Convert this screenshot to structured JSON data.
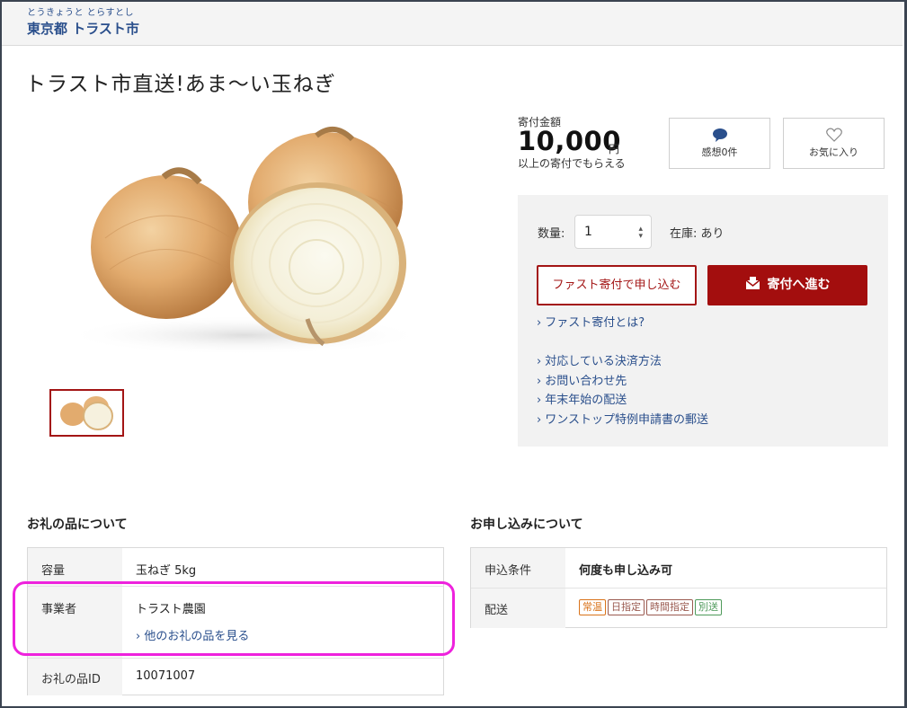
{
  "header": {
    "ruby": "とうきょうと とらすとし",
    "city": "東京都 トラスト市"
  },
  "product": {
    "title": "トラスト市直送!あま〜い玉ねぎ"
  },
  "price": {
    "label": "寄付金額",
    "amount": "10,000",
    "unit": "円",
    "note": "以上の寄付でもらえる"
  },
  "actions": {
    "reviews_label": "感想0件",
    "favorite_label": "お気に入り"
  },
  "order": {
    "qty_label": "数量:",
    "qty_value": "1",
    "stock_label": "在庫: あり",
    "fast_button": "ファスト寄付で申し込む",
    "donate_button": "寄付へ進む",
    "fast_link": "ファスト寄付とは?",
    "links": [
      "対応している決済方法",
      "お問い合わせ先",
      "年末年始の配送",
      "ワンストップ特例申請書の郵送"
    ]
  },
  "gift_info": {
    "title": "お礼の品について",
    "rows": [
      {
        "label": "容量",
        "value": "玉ねぎ 5kg"
      },
      {
        "label": "事業者",
        "value": "トラスト農園",
        "link": "他のお礼の品を見る"
      },
      {
        "label": "お礼の品ID",
        "value": "10071007"
      }
    ]
  },
  "apply_info": {
    "title": "お申し込みについて",
    "rows": [
      {
        "label": "申込条件",
        "value": "何度も申し込み可"
      },
      {
        "label": "配送",
        "tags": [
          "常温",
          "日指定",
          "時間指定",
          "別送"
        ]
      }
    ]
  },
  "colors": {
    "accent_red": "#a30e0e",
    "link_blue": "#2a4f8c",
    "highlight_magenta": "#ee22dd",
    "tag_colors": [
      "#d9731a",
      "#9a5a50",
      "#9a5a50",
      "#4e9a5a"
    ]
  },
  "icons": [
    "speech-bubble-icon",
    "heart-icon",
    "envelope-icon",
    "chevron-right-icon",
    "stepper-arrows-icon"
  ]
}
